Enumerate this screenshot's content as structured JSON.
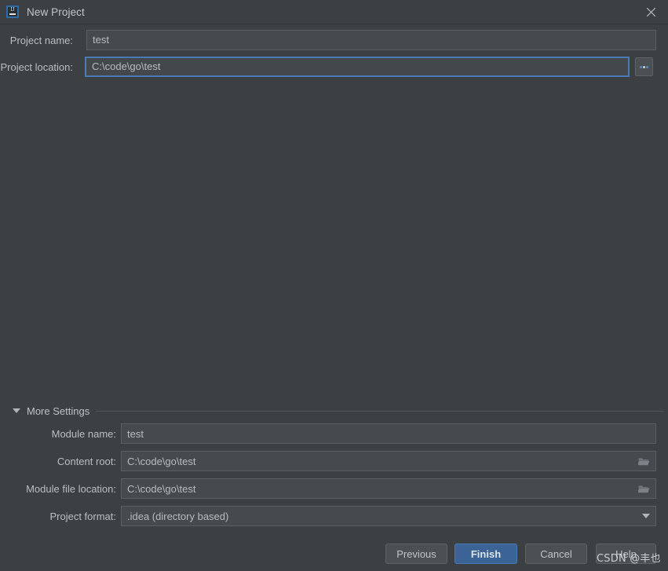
{
  "window": {
    "title": "New Project",
    "app_icon": "intellij-idea-icon",
    "close_icon": "close-icon"
  },
  "colors": {
    "background": "#3c4043",
    "field_background": "#454a4e",
    "field_border": "#5a5f64",
    "focus_border": "#4a7ab5",
    "accent_button": "#3c6395",
    "text": "#bfc4c9"
  },
  "form": {
    "project_name": {
      "label": "Project name:",
      "value": "test",
      "placeholder": ""
    },
    "project_location": {
      "label": "Project location:",
      "value": "C:\\code\\go\\test",
      "placeholder": "",
      "focused": true,
      "browse_label": "..."
    }
  },
  "more_settings": {
    "label": "More Settings",
    "expanded": true,
    "toggle_icon": "triangle-down-icon",
    "rows": [
      {
        "label": "Module name:",
        "value": "test",
        "type": "text",
        "icon": ""
      },
      {
        "label": "Content root:",
        "value": "C:\\code\\go\\test",
        "type": "path",
        "icon": "folder-icon"
      },
      {
        "label": "Module file location:",
        "value": "C:\\code\\go\\test",
        "type": "path",
        "icon": "folder-icon"
      },
      {
        "label": "Project format:",
        "value": ".idea (directory based)",
        "type": "select",
        "icon": "chevron-down-icon"
      }
    ]
  },
  "footer": {
    "previous": "Previous",
    "finish": "Finish",
    "cancel": "Cancel",
    "help": "Help"
  },
  "watermark": {
    "text": "CSDN @丰也"
  }
}
